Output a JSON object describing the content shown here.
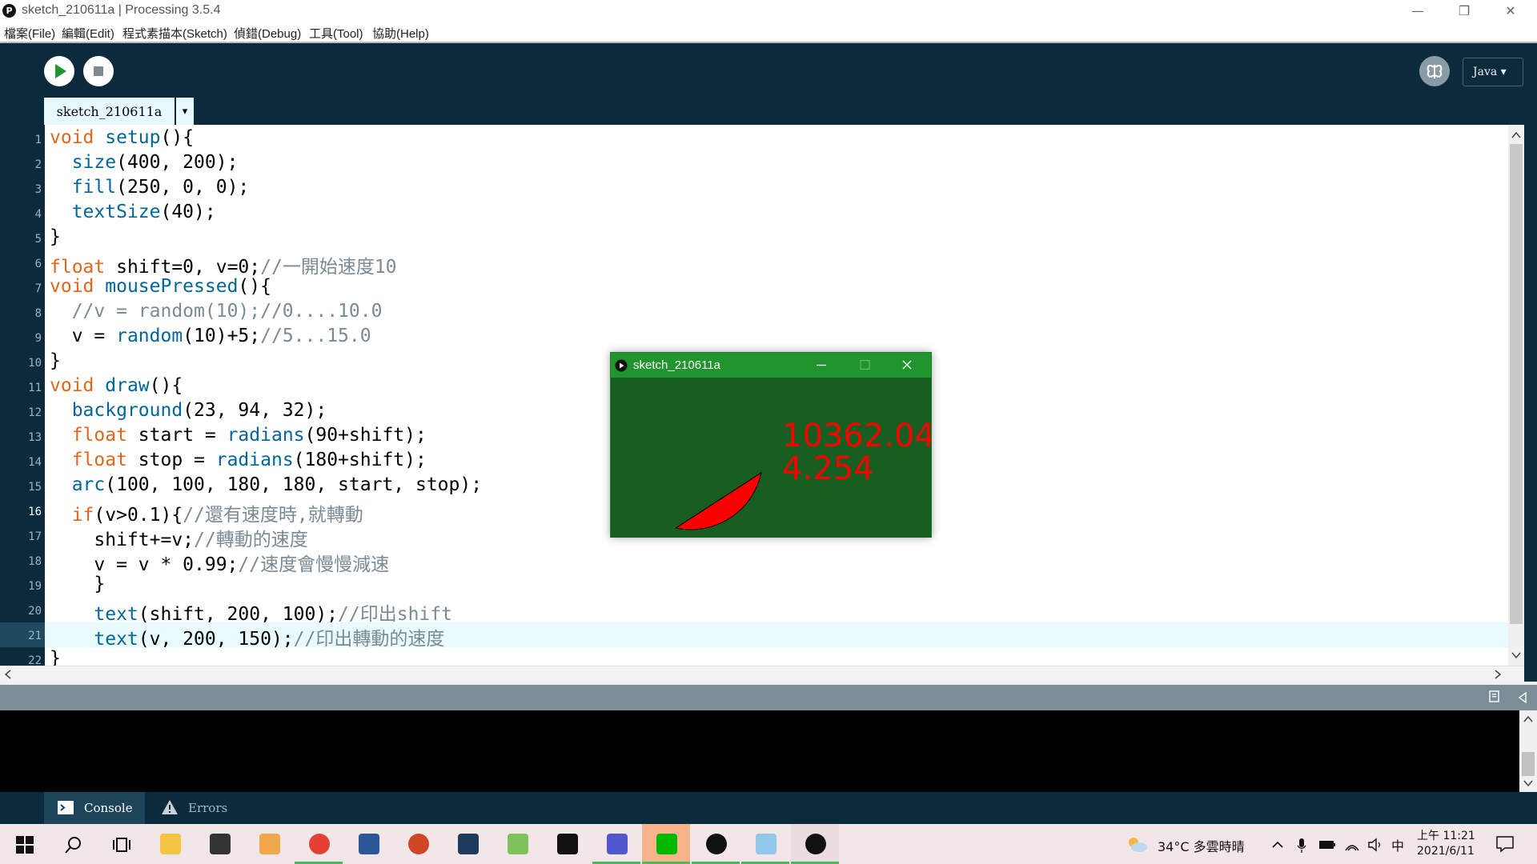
{
  "window": {
    "title": "sketch_210611a | Processing 3.5.4",
    "minimize": "—",
    "restore": "❐",
    "close": "✕"
  },
  "menu": [
    "檔案(File)",
    "編輯(Edit)",
    "程式素描本(Sketch)",
    "偵錯(Debug)",
    "工具(Tool)",
    "協助(Help)"
  ],
  "toolbar": {
    "run_icon": "play-icon",
    "stop_icon": "stop-icon",
    "mode": "Java ▾",
    "accent": "#21952d"
  },
  "tabs": {
    "active": "sketch_210611a",
    "menu_arrow": "▾"
  },
  "editor": {
    "current_line": 16,
    "lines": [
      [
        {
          "t": "void ",
          "c": "k"
        },
        {
          "t": "setup",
          "c": "f"
        },
        {
          "t": "(){"
        }
      ],
      [
        {
          "t": "  "
        },
        {
          "t": "size",
          "c": "f"
        },
        {
          "t": "(400, 200);"
        }
      ],
      [
        {
          "t": "  "
        },
        {
          "t": "fill",
          "c": "f"
        },
        {
          "t": "(250, 0, 0);"
        }
      ],
      [
        {
          "t": "  "
        },
        {
          "t": "textSize",
          "c": "f"
        },
        {
          "t": "(40);"
        }
      ],
      [
        {
          "t": "}"
        }
      ],
      [
        {
          "t": "float",
          "c": "k"
        },
        {
          "t": " shift=0, v=0;"
        },
        {
          "t": "//一開始速度10",
          "c": "c"
        }
      ],
      [
        {
          "t": "void ",
          "c": "k"
        },
        {
          "t": "mousePressed",
          "c": "f"
        },
        {
          "t": "(){"
        }
      ],
      [
        {
          "t": "  "
        },
        {
          "t": "//v = random(10);//0....10.0",
          "c": "c"
        }
      ],
      [
        {
          "t": "  v = "
        },
        {
          "t": "random",
          "c": "f"
        },
        {
          "t": "(10)+5;"
        },
        {
          "t": "//5...15.0",
          "c": "c"
        }
      ],
      [
        {
          "t": "}"
        }
      ],
      [
        {
          "t": "void ",
          "c": "k"
        },
        {
          "t": "draw",
          "c": "f"
        },
        {
          "t": "(){"
        }
      ],
      [
        {
          "t": "  "
        },
        {
          "t": "background",
          "c": "f"
        },
        {
          "t": "(23, 94, 32);"
        }
      ],
      [
        {
          "t": "  "
        },
        {
          "t": "float",
          "c": "k"
        },
        {
          "t": " start = "
        },
        {
          "t": "radians",
          "c": "f"
        },
        {
          "t": "(90+shift);"
        }
      ],
      [
        {
          "t": "  "
        },
        {
          "t": "float",
          "c": "k"
        },
        {
          "t": " stop = "
        },
        {
          "t": "radians",
          "c": "f"
        },
        {
          "t": "(180+shift);"
        }
      ],
      [
        {
          "t": "  "
        },
        {
          "t": "arc",
          "c": "f"
        },
        {
          "t": "(100, 100, 180, 180, start, stop);"
        }
      ],
      [
        {
          "t": "  "
        },
        {
          "t": "if",
          "c": "k"
        },
        {
          "t": "(v>0.1){"
        },
        {
          "t": "//還有速度時,就轉動",
          "c": "c"
        }
      ],
      [
        {
          "t": "    shift+=v;"
        },
        {
          "t": "//轉動的速度",
          "c": "c"
        }
      ],
      [
        {
          "t": "    v = v * 0.99;"
        },
        {
          "t": "//速度會慢慢減速",
          "c": "c"
        }
      ],
      [
        {
          "t": "    }"
        }
      ],
      [
        {
          "t": "    "
        },
        {
          "t": "text",
          "c": "f"
        },
        {
          "t": "(shift, 200, 100);"
        },
        {
          "t": "//印出shift",
          "c": "c"
        }
      ],
      [
        {
          "t": "    "
        },
        {
          "t": "text",
          "c": "f"
        },
        {
          "t": "(v, 200, 150);"
        },
        {
          "t": "//印出轉動的速度",
          "c": "c"
        }
      ],
      [
        {
          "t": "}"
        }
      ]
    ]
  },
  "console_tabs": {
    "console": "Console",
    "errors": "Errors"
  },
  "sketch_window": {
    "title": "sketch_210611a",
    "shift_text": "10362.04",
    "speed_text": "4.254",
    "bg": "#175e20",
    "fill": "#fa0000"
  },
  "taskbar": {
    "weather": "34°C  多雲時晴",
    "ime": "中",
    "time": "上午 11:21",
    "date": "2021/6/11",
    "apps": [
      "start-icon",
      "search-icon",
      "task-view-icon",
      "file-explorer-icon",
      "store-icon",
      "media-player-icon",
      "chrome-icon",
      "word-icon",
      "powerpoint-icon",
      "qr-app-icon",
      "git-app-icon",
      "devcode-icon",
      "teams-icon",
      "line-icon",
      "processing-icon",
      "paint-icon",
      "sketch-run-icon"
    ]
  }
}
